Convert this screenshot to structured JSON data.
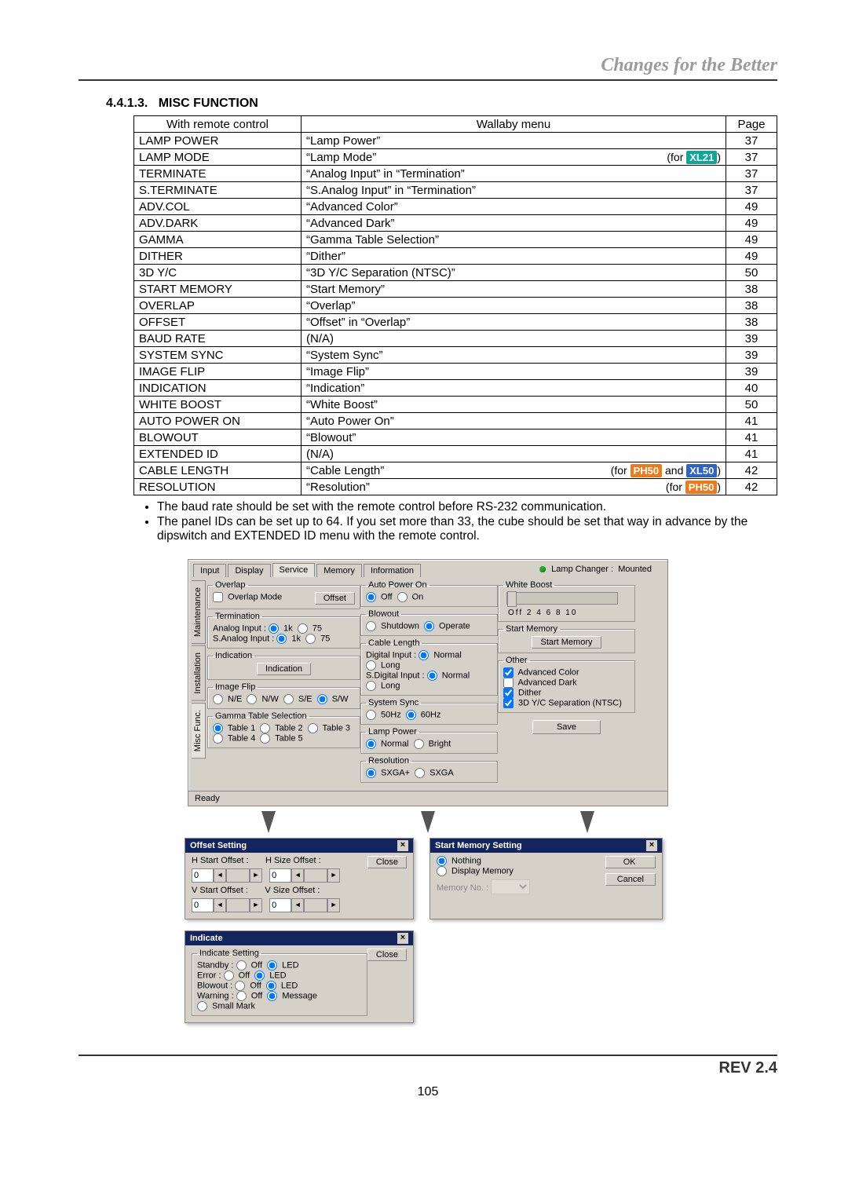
{
  "header": {
    "slogan": "Changes for the Better"
  },
  "section": {
    "number": "4.4.1.3.",
    "title": "MISC FUNCTION"
  },
  "table": {
    "headers": {
      "remote": "With remote control",
      "menu": "Wallaby menu",
      "page": "Page"
    },
    "rows": [
      {
        "remote": "LAMP POWER",
        "menu": "“Lamp Power”",
        "page": "37"
      },
      {
        "remote": "LAMP MODE",
        "menu": "“Lamp Mode”",
        "note_prefix": "(for ",
        "chips": [
          {
            "text": "XL21",
            "cls": "c-teal"
          }
        ],
        "note_suffix": ")",
        "page": "37"
      },
      {
        "remote": "TERMINATE",
        "menu": "“Analog Input” in “Termination”",
        "page": "37"
      },
      {
        "remote": "S.TERMINATE",
        "menu": "“S.Analog Input” in “Termination”",
        "page": "37"
      },
      {
        "remote": "ADV.COL",
        "menu": "“Advanced Color”",
        "page": "49"
      },
      {
        "remote": "ADV.DARK",
        "menu": "“Advanced Dark”",
        "page": "49"
      },
      {
        "remote": "GAMMA",
        "menu": "“Gamma Table Selection”",
        "page": "49"
      },
      {
        "remote": "DITHER",
        "menu": "“Dither”",
        "page": "49"
      },
      {
        "remote": "3D Y/C",
        "menu": "“3D Y/C Separation (NTSC)”",
        "page": "50"
      },
      {
        "remote": "START MEMORY",
        "menu": "“Start Memory”",
        "page": "38"
      },
      {
        "remote": "OVERLAP",
        "menu": "“Overlap”",
        "page": "38"
      },
      {
        "remote": "OFFSET",
        "menu": "“Offset” in “Overlap”",
        "page": "38"
      },
      {
        "remote": "BAUD RATE",
        "menu": "(N/A)",
        "page": "39"
      },
      {
        "remote": "SYSTEM SYNC",
        "menu": "“System Sync”",
        "page": "39"
      },
      {
        "remote": "IMAGE FLIP",
        "menu": "“Image Flip”",
        "page": "39"
      },
      {
        "remote": "INDICATION",
        "menu": "“Indication”",
        "page": "40"
      },
      {
        "remote": "WHITE BOOST",
        "menu": "“White Boost”",
        "page": "50"
      },
      {
        "remote": "AUTO POWER ON",
        "menu": "“Auto Power On”",
        "page": "41"
      },
      {
        "remote": "BLOWOUT",
        "menu": "“Blowout”",
        "page": "41"
      },
      {
        "remote": "EXTENDED ID",
        "menu": "(N/A)",
        "page": "41"
      },
      {
        "remote": "CABLE LENGTH",
        "menu": "“Cable Length”",
        "note_prefix": "(for ",
        "chips": [
          {
            "text": "PH50",
            "cls": "c-orange"
          },
          {
            "text": " and ",
            "cls": "plain"
          },
          {
            "text": "XL50",
            "cls": "c-blue"
          }
        ],
        "note_suffix": ")",
        "page": "42"
      },
      {
        "remote": "RESOLUTION",
        "menu": "“Resolution”",
        "note_prefix": "(for ",
        "chips": [
          {
            "text": "PH50",
            "cls": "c-orange"
          }
        ],
        "note_suffix": ")",
        "page": "42"
      }
    ]
  },
  "bullets": [
    "The baud rate should be set with the remote control before RS-232 communication.",
    "The panel IDs can be set up to 64. If you set more than 33, the cube should be set that way in advance by the dipswitch and EXTENDED ID menu with the remote control."
  ],
  "wallaby": {
    "tabs": [
      "Input",
      "Display",
      "Service",
      "Memory",
      "Information"
    ],
    "active_tab": "Service",
    "vtabs": [
      "Maintenance",
      "Installation",
      "Misc Func."
    ],
    "active_vtab": "Misc Func.",
    "lamp_status_label": "Lamp Changer :",
    "lamp_status_value": "Mounted",
    "overlap": {
      "legend": "Overlap",
      "checkbox": "Overlap Mode",
      "button": "Offset"
    },
    "termination": {
      "legend": "Termination",
      "rows": [
        {
          "label": "Analog Input :",
          "opts": [
            "1k",
            "75"
          ],
          "sel": 0
        },
        {
          "label": "S.Analog Input :",
          "opts": [
            "1k",
            "75"
          ],
          "sel": 0
        }
      ]
    },
    "indication": {
      "legend": "Indication",
      "button": "Indication"
    },
    "imageflip": {
      "legend": "Image Flip",
      "opts": [
        "N/E",
        "N/W",
        "S/E",
        "S/W"
      ],
      "sel": 3
    },
    "gamma": {
      "legend": "Gamma Table Selection",
      "opts": [
        "Table 1",
        "Table 2",
        "Table 3",
        "Table 4",
        "Table 5"
      ],
      "sel": 0
    },
    "autopower": {
      "legend": "Auto Power On",
      "opts": [
        "Off",
        "On"
      ],
      "sel": 0
    },
    "blowout": {
      "legend": "Blowout",
      "opts": [
        "Shutdown",
        "Operate"
      ],
      "sel": 1
    },
    "cablelen": {
      "legend": "Cable Length",
      "rows": [
        {
          "label": "Digital Input :",
          "opts": [
            "Normal",
            "Long"
          ],
          "sel": 0
        },
        {
          "label": "S.Digital Input :",
          "opts": [
            "Normal",
            "Long"
          ],
          "sel": 0
        }
      ]
    },
    "syssync": {
      "legend": "System Sync",
      "opts": [
        "50Hz",
        "60Hz"
      ],
      "sel": 1
    },
    "lamppower": {
      "legend": "Lamp Power",
      "opts": [
        "Normal",
        "Bright"
      ],
      "sel": 0
    },
    "resolution": {
      "legend": "Resolution",
      "opts": [
        "SXGA+",
        "SXGA"
      ],
      "sel": 0
    },
    "whiteboost": {
      "legend": "White Boost",
      "ticks": "Off   2    4    6    8   10"
    },
    "startmem": {
      "legend": "Start Memory",
      "button": "Start Memory"
    },
    "other": {
      "legend": "Other",
      "checks": [
        {
          "label": "Advanced Color",
          "checked": true
        },
        {
          "label": "Advanced Dark",
          "checked": false
        },
        {
          "label": "Dither",
          "checked": true
        },
        {
          "label": "3D Y/C Separation (NTSC)",
          "checked": true
        }
      ]
    },
    "save": "Save",
    "status": "Ready"
  },
  "offset_dlg": {
    "title": "Offset Setting",
    "h_start": "H Start Offset :",
    "h_size": "H Size Offset :",
    "v_start": "V Start Offset :",
    "v_size": "V Size Offset :",
    "value": "0",
    "close": "Close"
  },
  "startmem_dlg": {
    "title": "Start Memory Setting",
    "opts": [
      "Nothing",
      "Display Memory"
    ],
    "sel": 0,
    "memno": "Memory No. :",
    "ok": "OK",
    "cancel": "Cancel"
  },
  "indicate_dlg": {
    "title": "Indicate",
    "legend": "Indicate Setting",
    "rows": [
      {
        "label": "Standby :",
        "opts": [
          "Off",
          "LED"
        ],
        "sel": 1
      },
      {
        "label": "Error :",
        "opts": [
          "Off",
          "LED"
        ],
        "sel": 1
      },
      {
        "label": "Blowout :",
        "opts": [
          "Off",
          "LED"
        ],
        "sel": 1
      },
      {
        "label": "Warning :",
        "opts": [
          "Off",
          "Message",
          "Small Mark"
        ],
        "sel": 1
      }
    ],
    "close": "Close"
  },
  "footer": {
    "rev": "REV 2.4",
    "page": "105"
  }
}
